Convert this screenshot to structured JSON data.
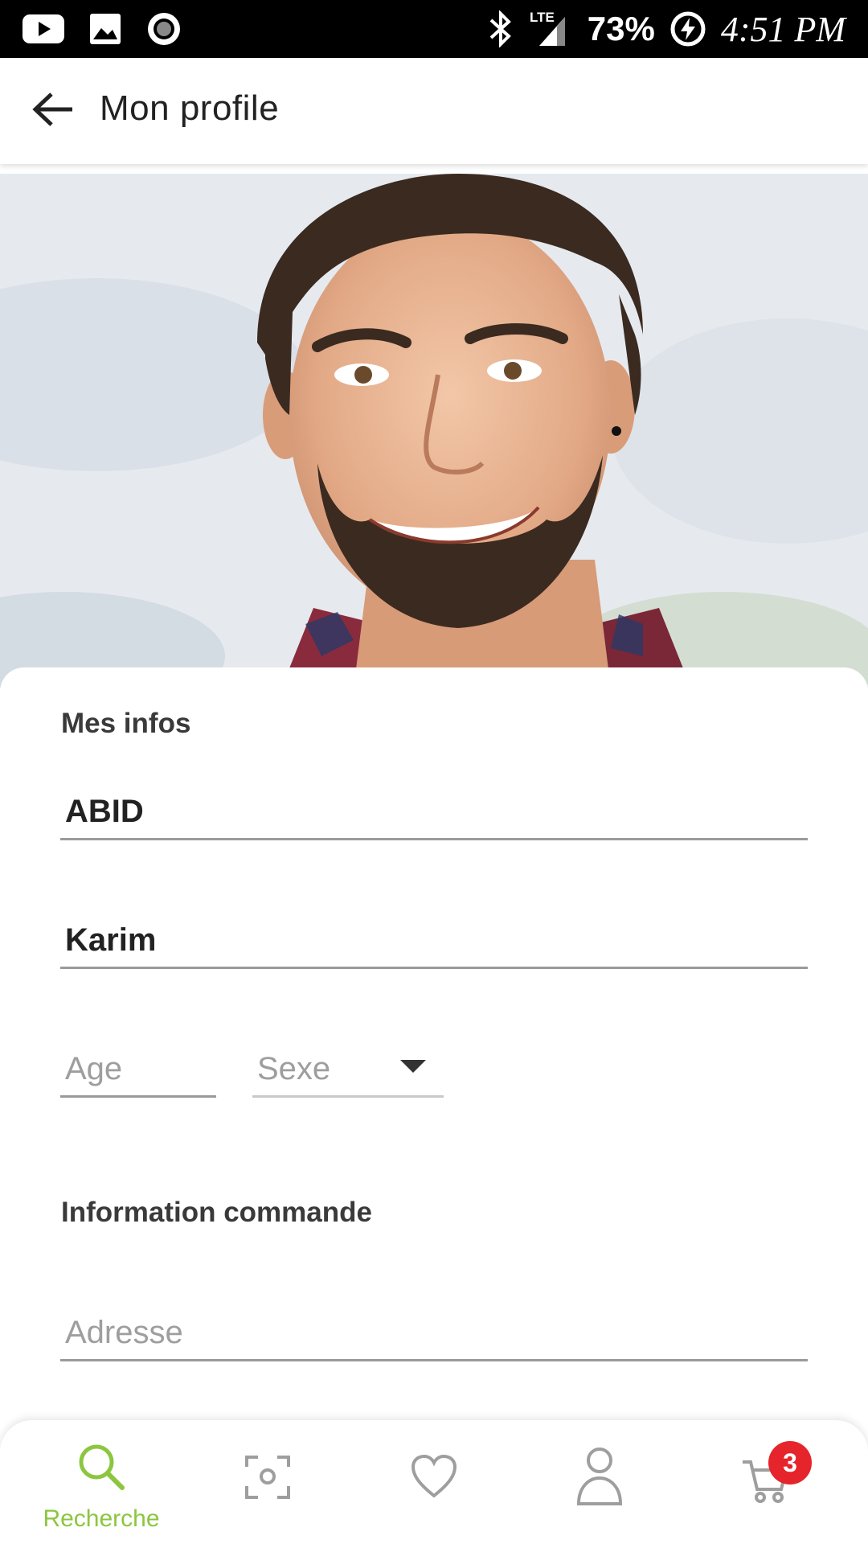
{
  "status_bar": {
    "battery": "73%",
    "time": "4:51 PM",
    "icons": [
      "youtube-icon",
      "image-icon",
      "record-icon",
      "bluetooth-icon",
      "lte-signal-icon",
      "battery-charging-icon"
    ]
  },
  "app_bar": {
    "title": "Mon profile",
    "back_icon": "arrow-left-icon"
  },
  "profile": {
    "photo_alt": "profile-photo"
  },
  "mes_infos": {
    "title": "Mes infos",
    "last_name": "ABID",
    "first_name": "Karim",
    "age_placeholder": "Age",
    "sexe_placeholder": "Sexe"
  },
  "commande": {
    "title": "Information commande",
    "adresse_placeholder": "Adresse"
  },
  "bottom_nav": {
    "items": [
      {
        "label": "Recherche",
        "icon": "search-icon",
        "active": true
      },
      {
        "label": "",
        "icon": "scan-icon",
        "active": false
      },
      {
        "label": "",
        "icon": "heart-icon",
        "active": false
      },
      {
        "label": "",
        "icon": "user-icon",
        "active": false
      },
      {
        "label": "",
        "icon": "cart-icon",
        "active": false
      }
    ],
    "cart_badge": "3"
  },
  "colors": {
    "accent": "#8cc63f",
    "badge": "#e5242b",
    "inactive_icon": "#9e9e9e"
  }
}
